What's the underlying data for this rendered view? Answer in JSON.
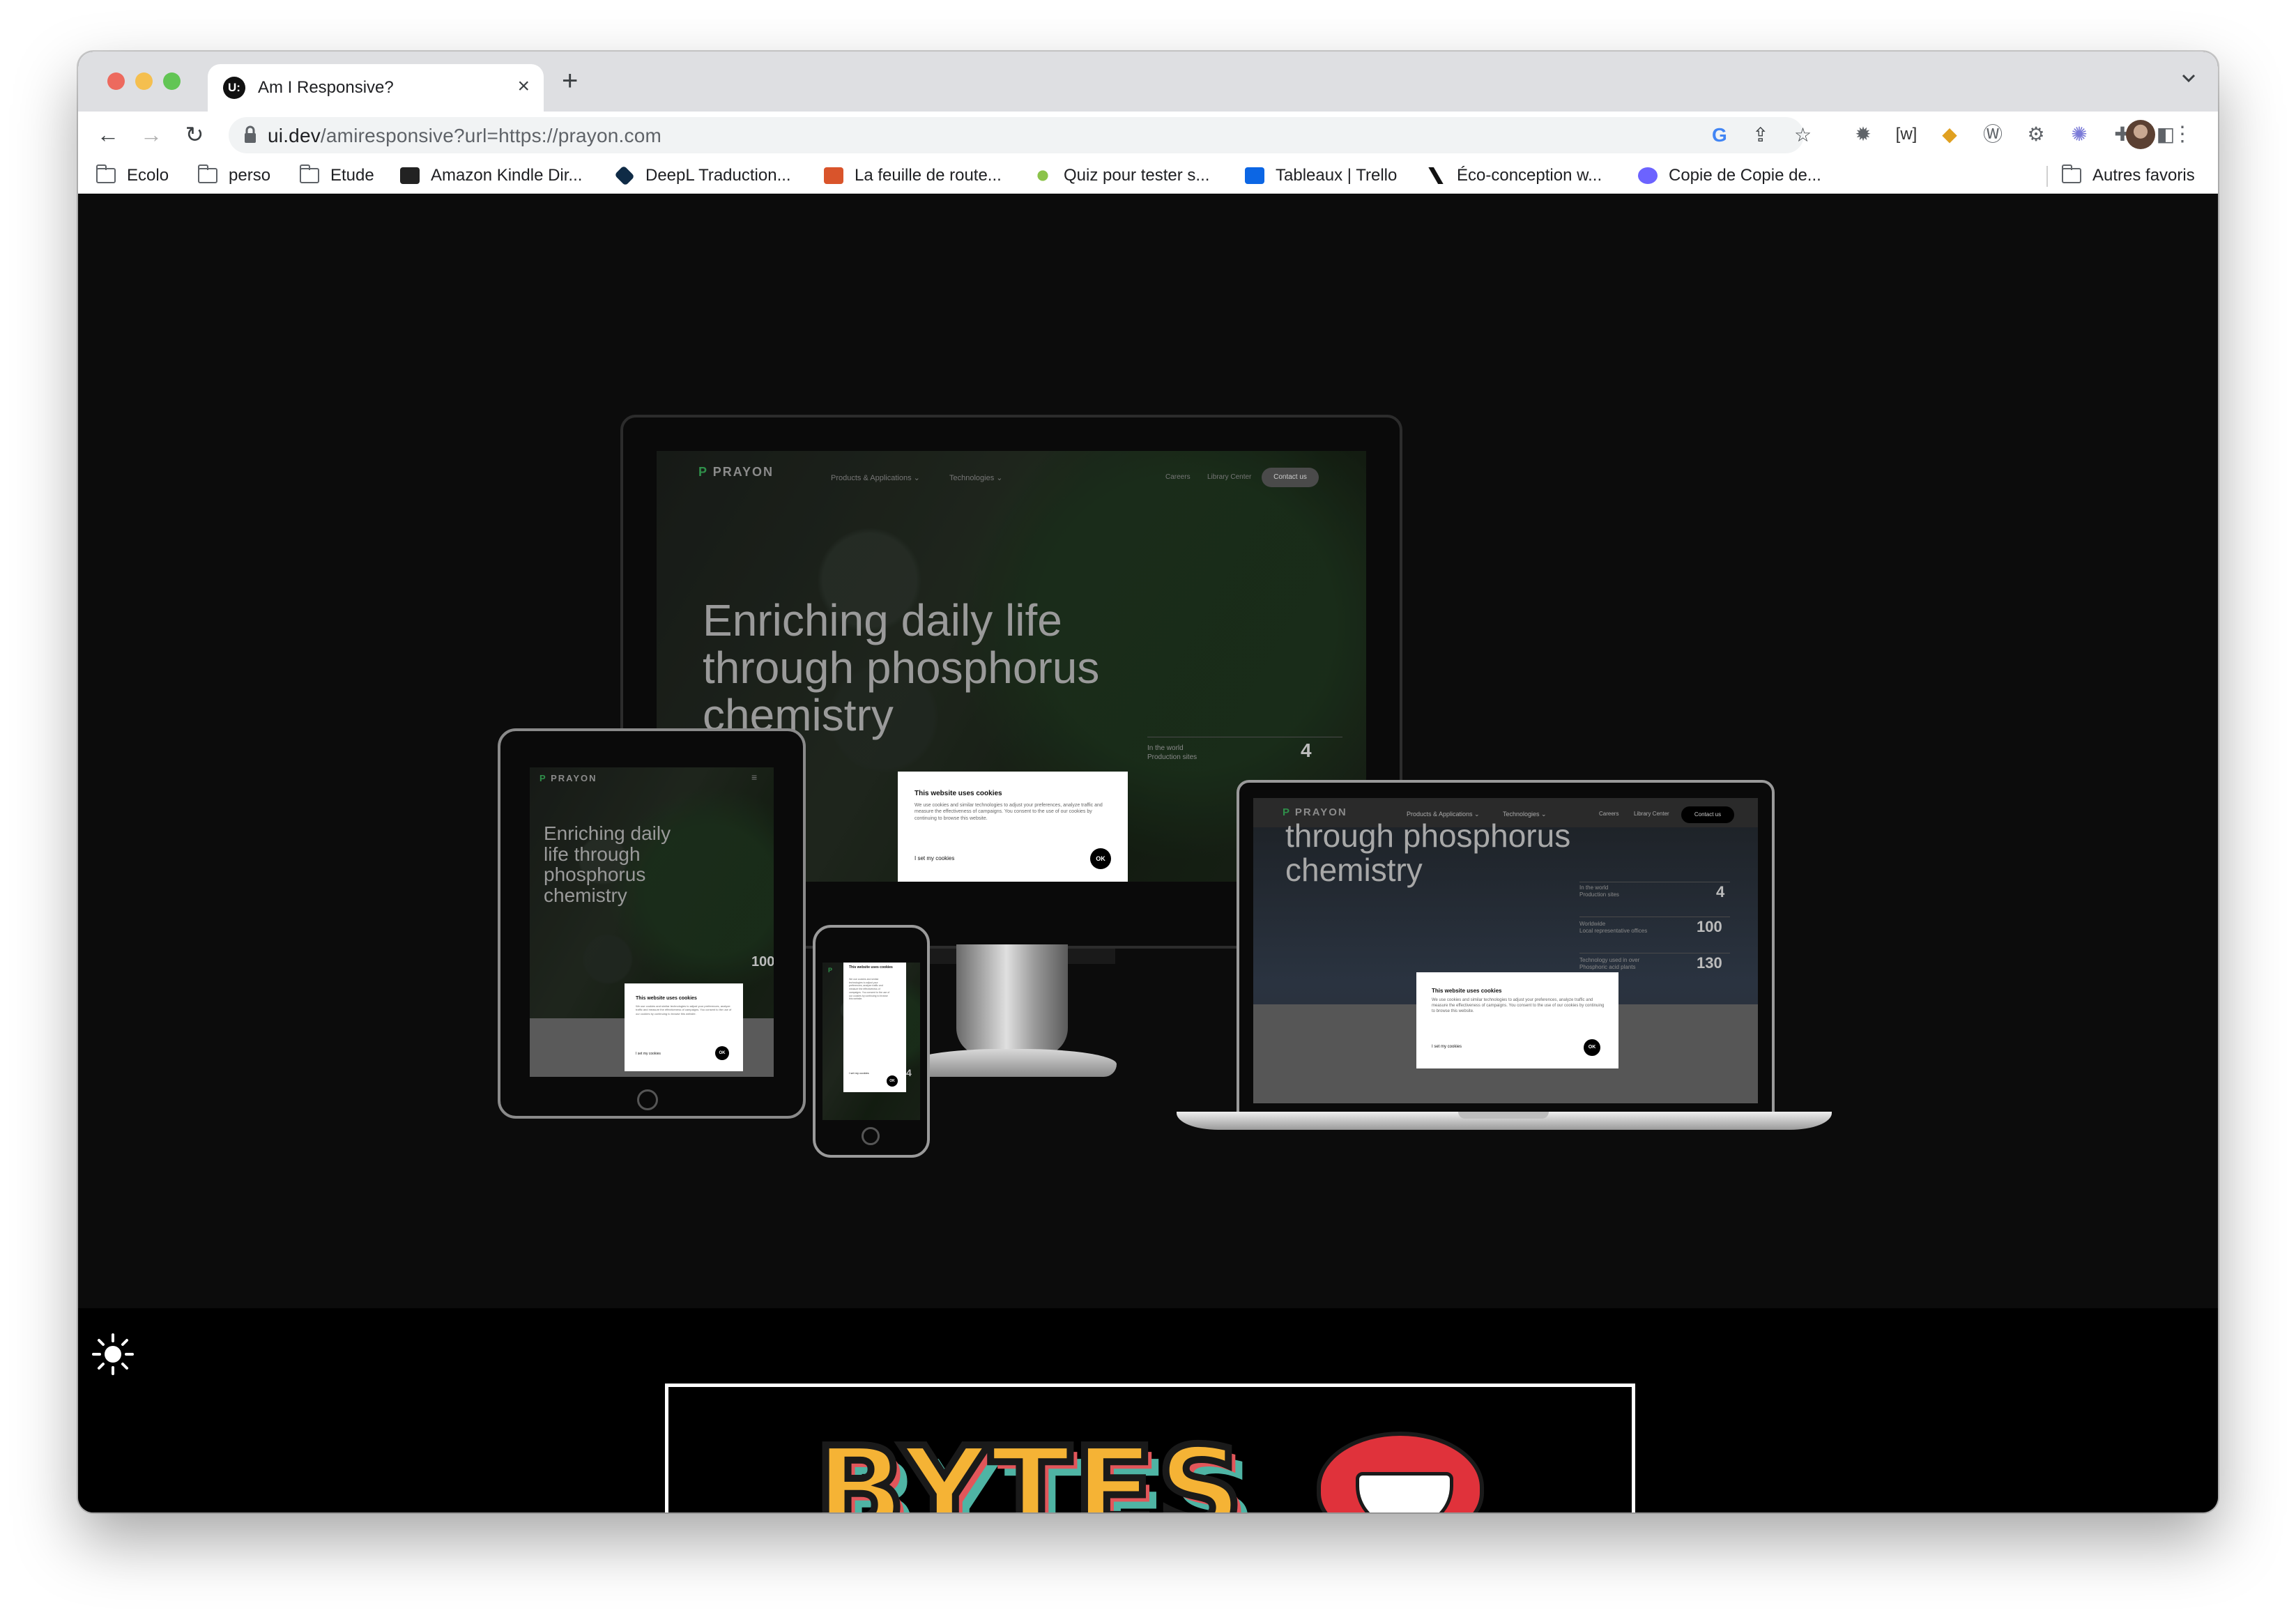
{
  "browser": {
    "tab": {
      "title": "Am I Responsive?",
      "favicon": "U:"
    },
    "url": {
      "host": "ui.dev",
      "path": "/amiresponsive?url=https://prayon.com"
    },
    "bookmarks": [
      {
        "label": "Ecolo",
        "icon": "folder-icon"
      },
      {
        "label": "perso",
        "icon": "folder-icon"
      },
      {
        "label": "Etude",
        "icon": "folder-icon"
      },
      {
        "label": "Amazon Kindle Dir...",
        "icon": "amazon-icon"
      },
      {
        "label": "DeepL Traduction...",
        "icon": "deepl-icon"
      },
      {
        "label": "La feuille de route...",
        "icon": "roadmap-icon"
      },
      {
        "label": "Quiz pour tester s...",
        "icon": "quiz-icon"
      },
      {
        "label": "Tableaux | Trello",
        "icon": "trello-icon"
      },
      {
        "label": "Éco-conception w...",
        "icon": "eco-icon"
      },
      {
        "label": "Copie de Copie de...",
        "icon": "copy-icon"
      }
    ],
    "other_bookmarks": "Autres favoris"
  },
  "site": {
    "logo": "PRAYON",
    "nav": [
      "Products & Applications ⌄",
      "Technologies ⌄"
    ],
    "nav_right": [
      "Careers",
      "Library Center"
    ],
    "cta": "Contact us",
    "hero_desktop": "Enriching daily life\nthrough phosphorus\nchemistry",
    "hero_tablet": "Enriching daily\nlife through\nphosphorus\nchemistry",
    "hero_laptop": "through phosphorus\nchemistry",
    "stats": [
      {
        "label_top": "In the world",
        "label": "Production sites",
        "value": "4"
      },
      {
        "label_top": "Worldwide",
        "label": "Local representative offices",
        "value": "100"
      },
      {
        "label_top": "Technology used in over",
        "label": "Phosphoric acid plants",
        "value": "130"
      }
    ],
    "cookie": {
      "title": "This website uses cookies",
      "body": "We use cookies and similar technologies to adjust your preferences, analyze traffic and measure the effectiveness of campaigns. You consent to the use of our cookies by continuing to browse this website.",
      "settings": "I set my cookies",
      "ok": "OK"
    }
  },
  "banner": {
    "text": "BYTES"
  }
}
